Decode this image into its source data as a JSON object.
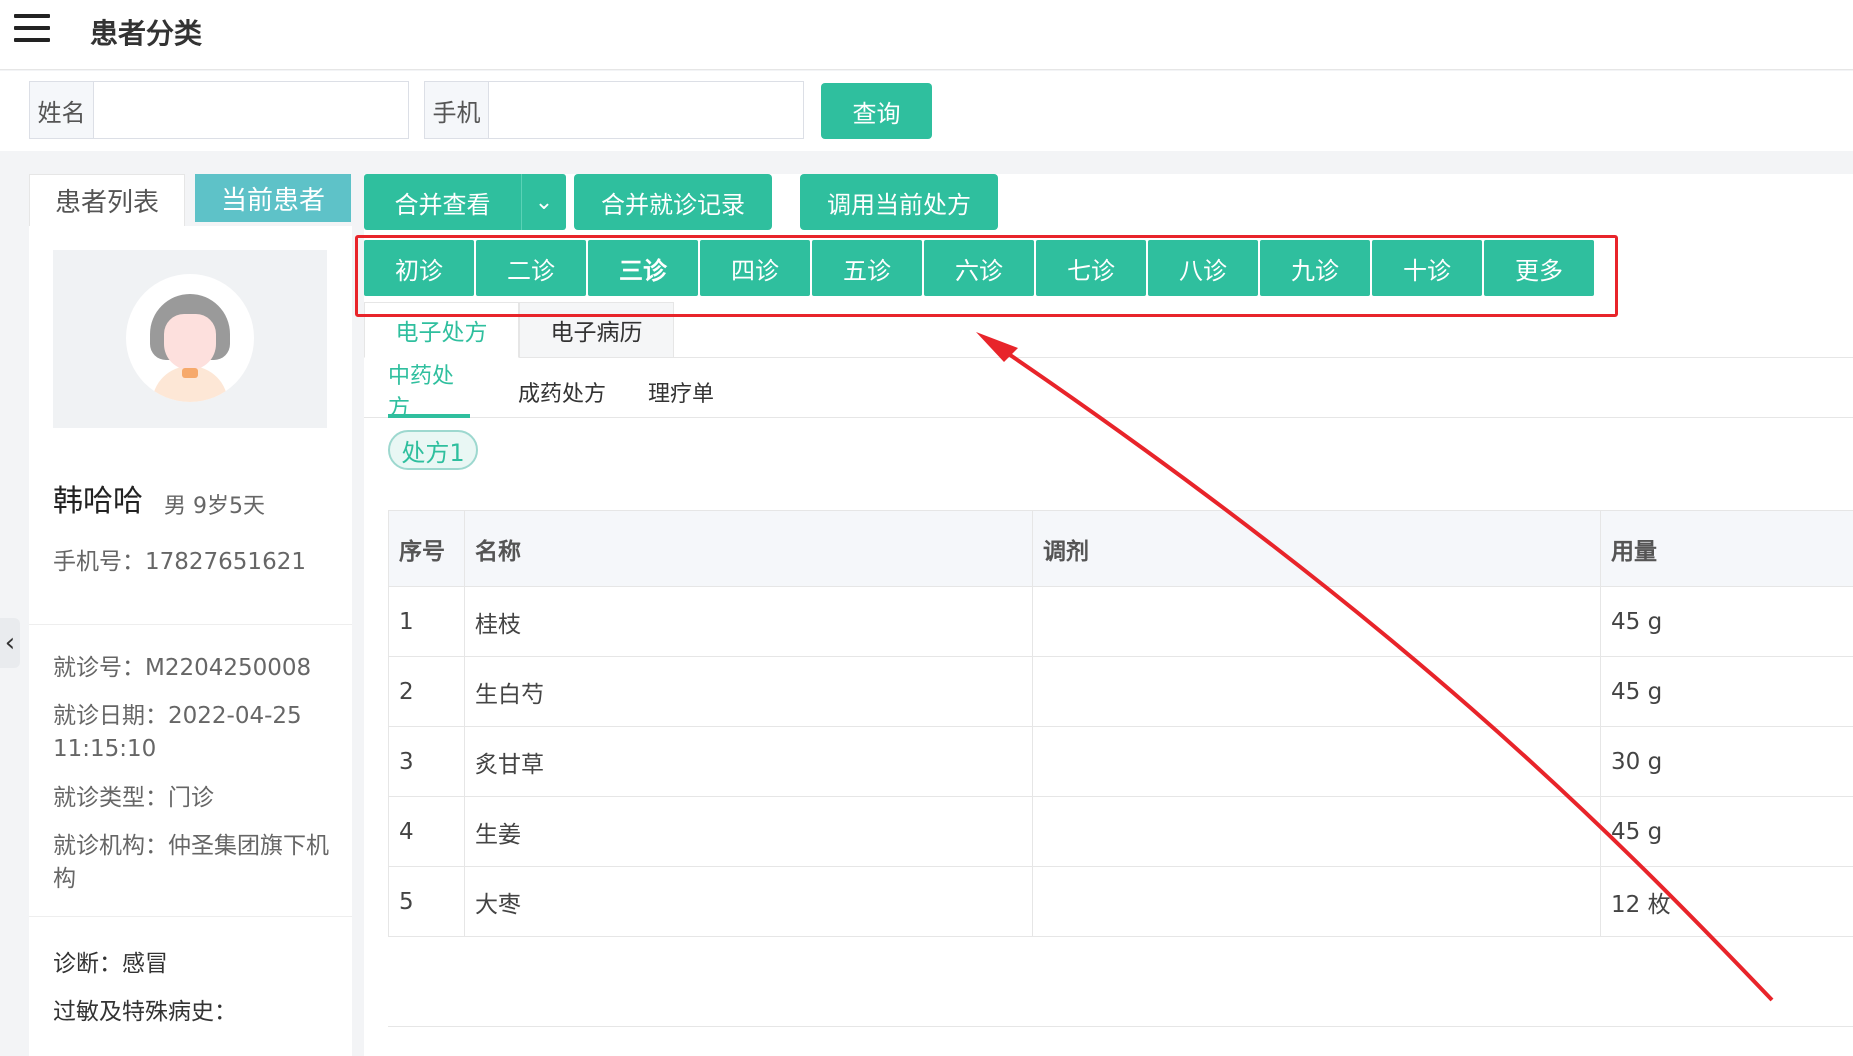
{
  "header": {
    "title": "患者分类"
  },
  "search": {
    "name_label": "姓名",
    "name_value": "",
    "name_placeholder": "",
    "phone_label": "手机",
    "phone_value": "",
    "phone_placeholder": "",
    "query_label": "查询"
  },
  "left_tabs": {
    "patient_list": "患者列表",
    "current_patient": "当前患者"
  },
  "patient": {
    "name": "韩哈哈",
    "meta": "男 9岁5天",
    "phone": "手机号：17827651621",
    "visit_no": "就诊号：M2204250008",
    "visit_date": "就诊日期：2022-04-25 11:15:10",
    "visit_type": "就诊类型：门诊",
    "visit_org": "就诊机构：仲圣集团旗下机构",
    "diagnosis": "诊断：感冒",
    "allergy": "过敏及特殊病史："
  },
  "toolbar": {
    "merge_view": "合并查看",
    "merge_records": "合并就诊记录",
    "use_current_rx": "调用当前处方"
  },
  "visits": [
    {
      "label": "初诊"
    },
    {
      "label": "二诊"
    },
    {
      "label": "三诊",
      "active": true
    },
    {
      "label": "四诊"
    },
    {
      "label": "五诊"
    },
    {
      "label": "六诊"
    },
    {
      "label": "七诊"
    },
    {
      "label": "八诊"
    },
    {
      "label": "九诊"
    },
    {
      "label": "十诊"
    },
    {
      "label": "更多"
    }
  ],
  "doc_tabs": {
    "e_rx": "电子处方",
    "e_record": "电子病历"
  },
  "rx_tabs": {
    "tcm": "中药处方",
    "patent": "成药处方",
    "therapy": "理疗单"
  },
  "rx_chip": "处方1",
  "table": {
    "headers": [
      "序号",
      "名称",
      "调剂",
      "用量"
    ],
    "rows": [
      [
        "1",
        "桂枝",
        "",
        "45 g"
      ],
      [
        "2",
        "生白芍",
        "",
        "45 g"
      ],
      [
        "3",
        "炙甘草",
        "",
        "30 g"
      ],
      [
        "4",
        "生姜",
        "",
        "45 g"
      ],
      [
        "5",
        "大枣",
        "",
        "12 枚"
      ]
    ]
  },
  "colors": {
    "primary": "#2fbf9e",
    "accent_tab": "#5ec2c8",
    "annotation": "#e8242a"
  },
  "icons": {
    "menu": "hamburger-menu-icon",
    "caret": "chevron-down-icon",
    "collapse": "chevron-left-icon"
  }
}
